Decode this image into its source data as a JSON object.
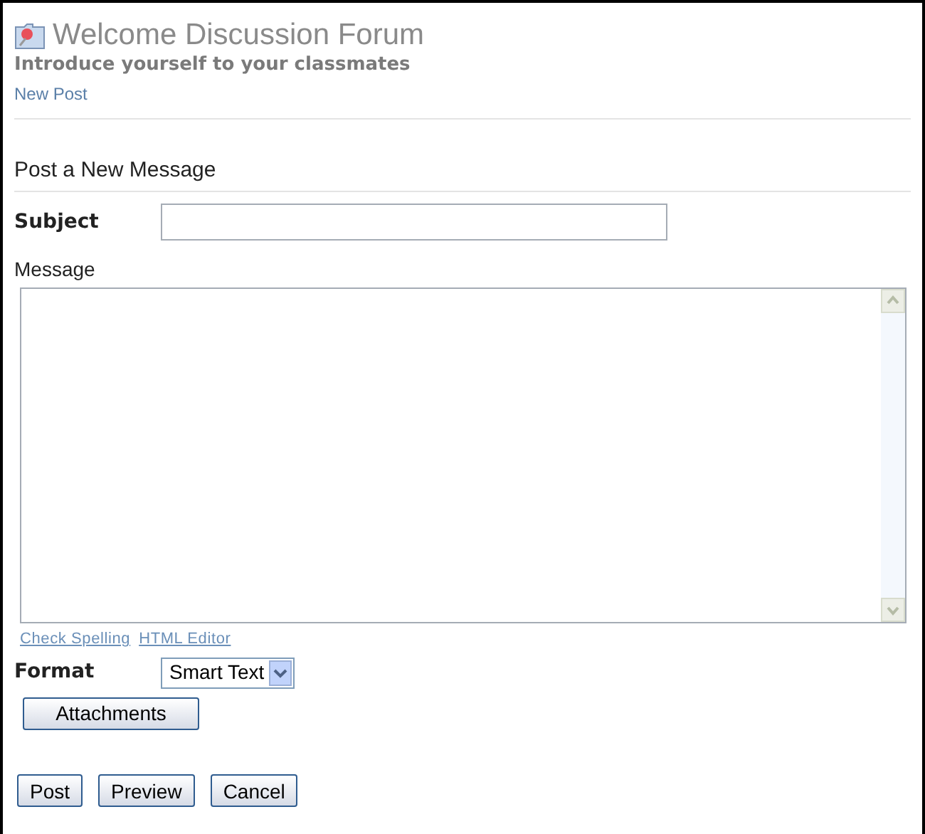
{
  "header": {
    "title": "Welcome Discussion Forum",
    "subtitle": "Introduce yourself to your classmates",
    "link": "New Post"
  },
  "form": {
    "heading": "Post a New Message",
    "subject_label": "Subject",
    "message_label": "Message",
    "editor_links": [
      "Check Spelling",
      "HTML Editor"
    ],
    "format_label": "Format",
    "format_value": "Smart Text",
    "attachments_button": "Attachments",
    "buttons": [
      "Post",
      "Preview",
      "Cancel"
    ]
  }
}
